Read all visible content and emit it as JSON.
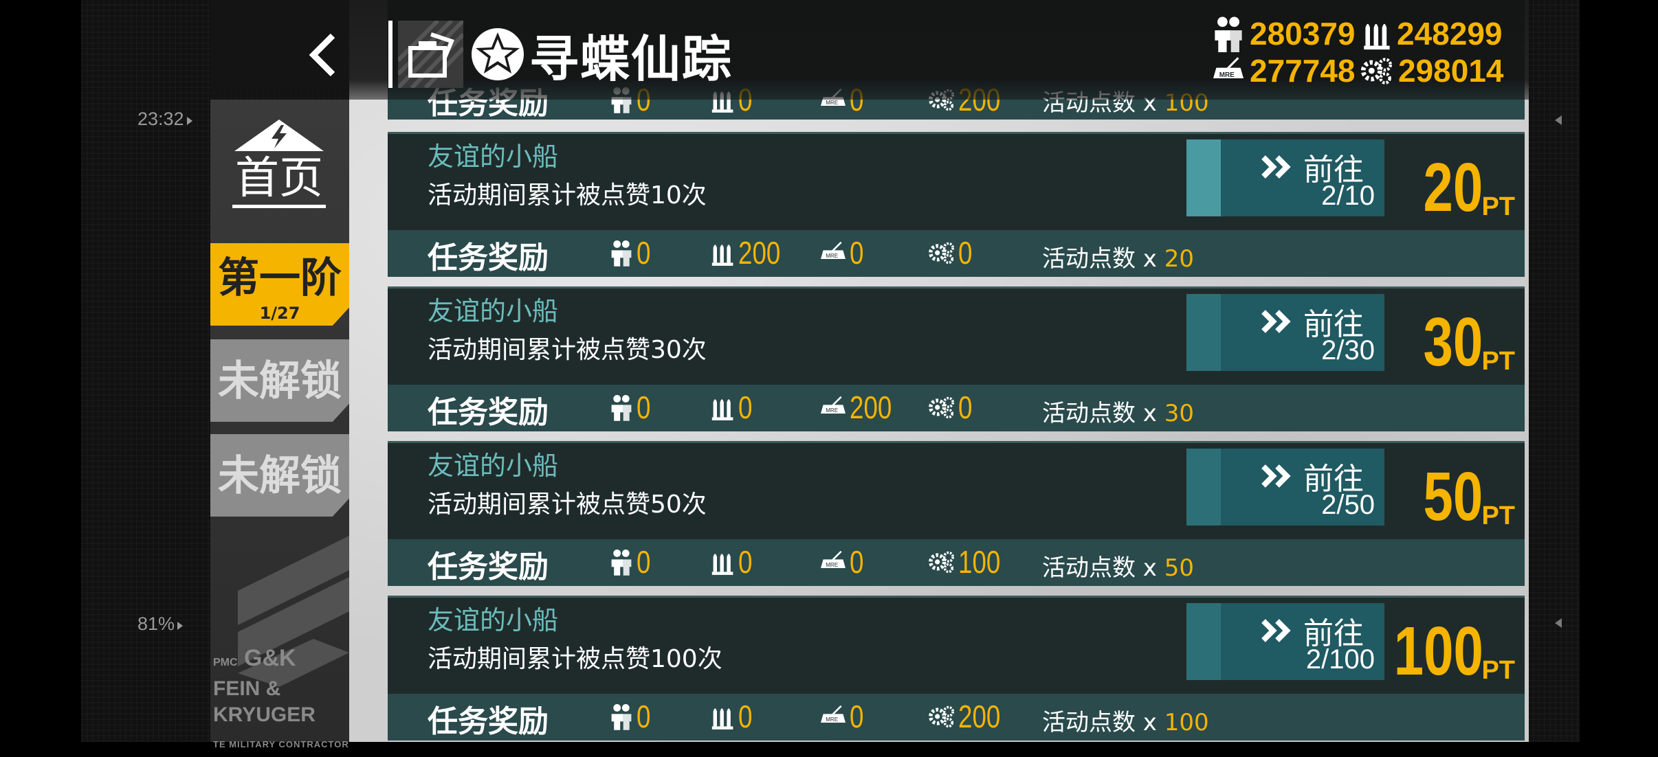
{
  "status": {
    "time": "23:32",
    "battery": "81%"
  },
  "header": {
    "title": "寻蝶仙踪",
    "resources": {
      "manpower": "280379",
      "ammo": "248299",
      "rations": "277748",
      "parts": "298014"
    }
  },
  "sidebar": {
    "home_label": "首页",
    "tiers": [
      {
        "label": "第一阶",
        "progress": "1/27"
      },
      {
        "label": "未解锁"
      },
      {
        "label": "未解锁"
      }
    ],
    "company": {
      "prefix": "PMC",
      "logo": "G&K",
      "name": "FEIN & KRYUGER",
      "sub": "TE MILITARY CONTRACTOR"
    }
  },
  "reward_label": "任务奖励",
  "goto_label": "前往",
  "act_points_label": "活动点数 x ",
  "pt_unit": "PT",
  "top_partial": {
    "manpower": "0",
    "ammo": "0",
    "rations": "0",
    "parts": "200",
    "act": "100"
  },
  "tasks": [
    {
      "name": "友谊的小船",
      "desc": "活动期间累计被点赞10次",
      "progress": "2/10",
      "points": "20",
      "rewards": {
        "manpower": "0",
        "ammo": "200",
        "rations": "0",
        "parts": "0"
      },
      "act": "20"
    },
    {
      "name": "友谊的小船",
      "desc": "活动期间累计被点赞30次",
      "progress": "2/30",
      "points": "30",
      "rewards": {
        "manpower": "0",
        "ammo": "0",
        "rations": "200",
        "parts": "0"
      },
      "act": "30"
    },
    {
      "name": "友谊的小船",
      "desc": "活动期间累计被点赞50次",
      "progress": "2/50",
      "points": "50",
      "rewards": {
        "manpower": "0",
        "ammo": "0",
        "rations": "0",
        "parts": "100"
      },
      "act": "50"
    },
    {
      "name": "友谊的小船",
      "desc": "活动期间累计被点赞100次",
      "progress": "2/100",
      "points": "100",
      "rewards": {
        "manpower": "0",
        "ammo": "0",
        "rations": "0",
        "parts": "200"
      },
      "act": "100"
    }
  ],
  "colors": {
    "accent": "#f5b400",
    "teal": "#6bbcbc",
    "card": "#1f2b2b",
    "reward_row": "#2a4a4c"
  }
}
